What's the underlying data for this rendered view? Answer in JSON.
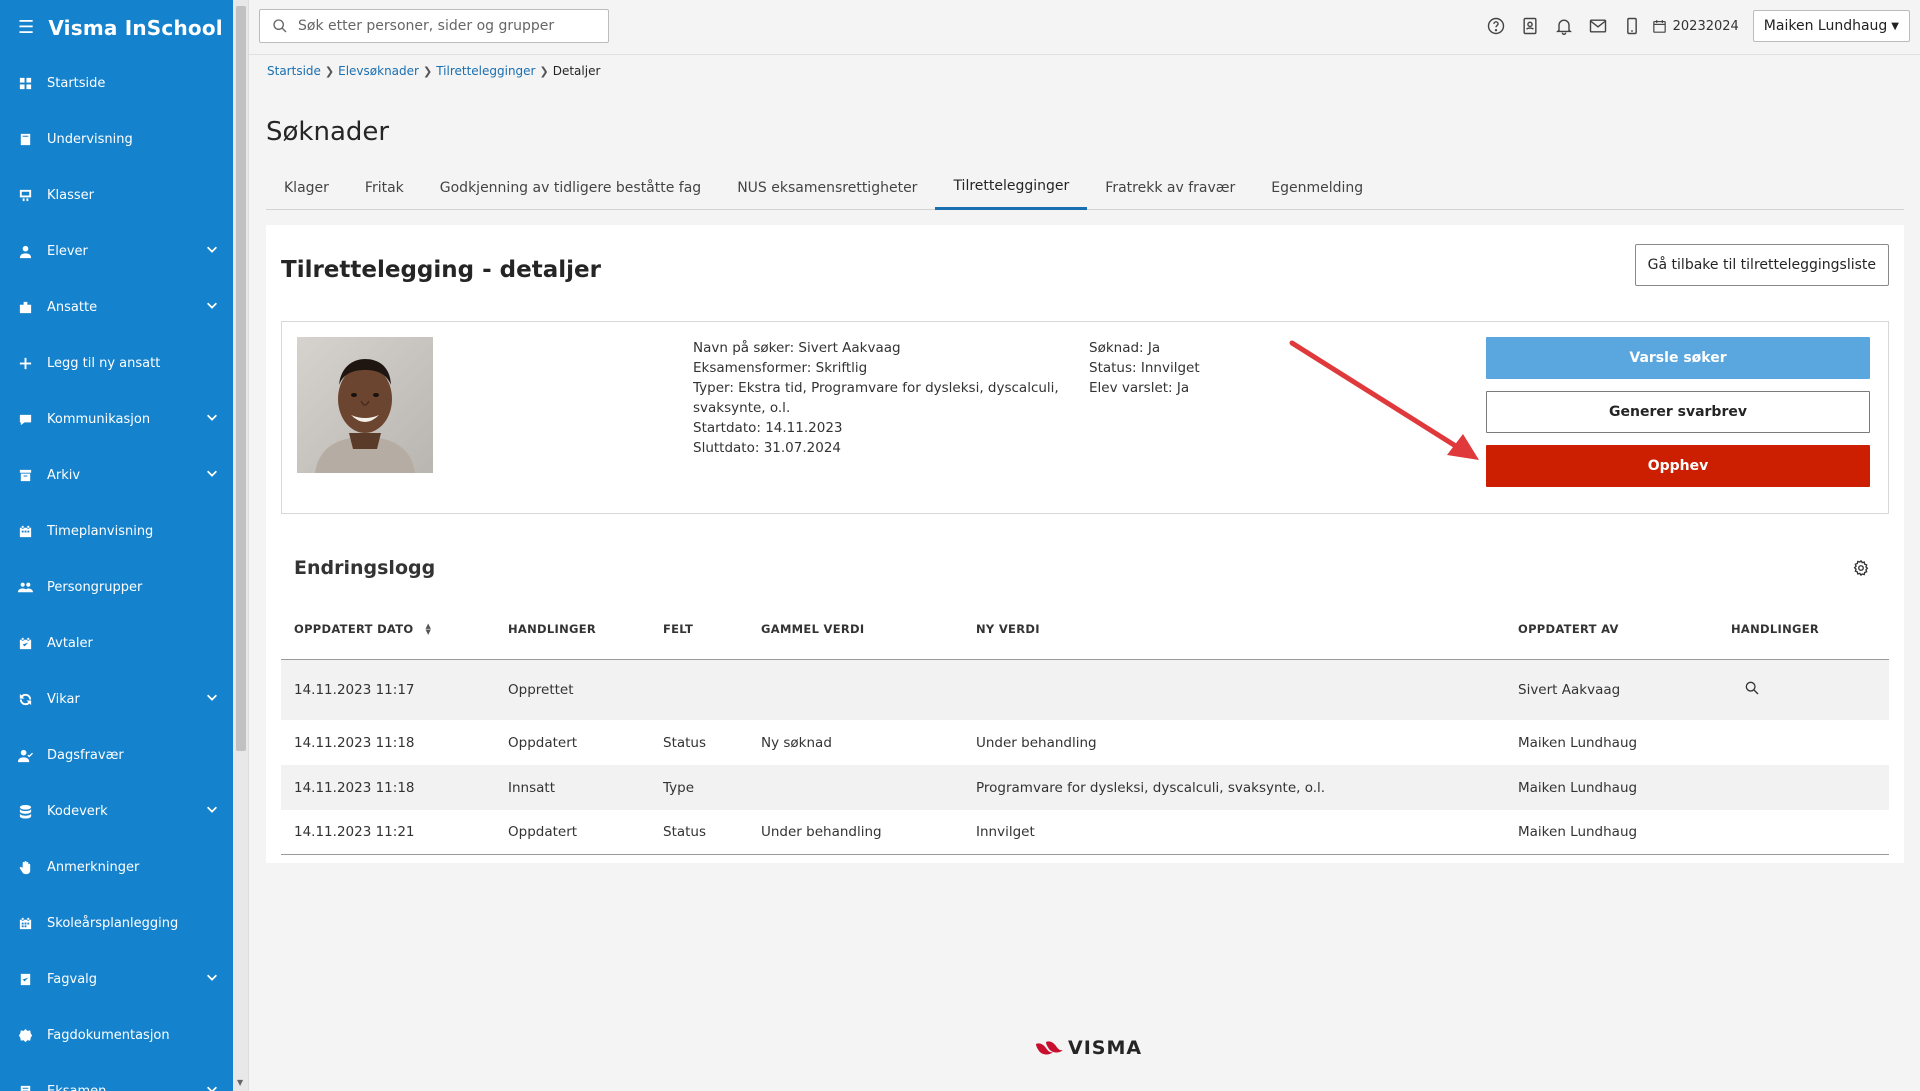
{
  "app": {
    "title": "Visma InSchool"
  },
  "sidebar": {
    "items": [
      {
        "label": "Startside",
        "icon": "grid-icon",
        "expandable": false
      },
      {
        "label": "Undervisning",
        "icon": "book-icon",
        "expandable": false
      },
      {
        "label": "Klasser",
        "icon": "board-icon",
        "expandable": false
      },
      {
        "label": "Elever",
        "icon": "student-icon",
        "expandable": true
      },
      {
        "label": "Ansatte",
        "icon": "briefcase-icon",
        "expandable": true
      },
      {
        "label": "Legg til ny ansatt",
        "icon": "plus-icon",
        "expandable": false
      },
      {
        "label": "Kommunikasjon",
        "icon": "chat-icon",
        "expandable": true
      },
      {
        "label": "Arkiv",
        "icon": "archive-icon",
        "expandable": true
      },
      {
        "label": "Timeplanvisning",
        "icon": "calendar-icon",
        "expandable": false
      },
      {
        "label": "Persongrupper",
        "icon": "group-icon",
        "expandable": false
      },
      {
        "label": "Avtaler",
        "icon": "calendar-check-icon",
        "expandable": false
      },
      {
        "label": "Vikar",
        "icon": "refresh-icon",
        "expandable": true
      },
      {
        "label": "Dagsfravær",
        "icon": "user-check-icon",
        "expandable": false
      },
      {
        "label": "Kodeverk",
        "icon": "database-icon",
        "expandable": true
      },
      {
        "label": "Anmerkninger",
        "icon": "hand-icon",
        "expandable": false
      },
      {
        "label": "Skoleårsplanlegging",
        "icon": "calendar-grid-icon",
        "expandable": false
      },
      {
        "label": "Fagvalg",
        "icon": "book-check-icon",
        "expandable": true
      },
      {
        "label": "Fagdokumentasjon",
        "icon": "badge-icon",
        "expandable": false
      },
      {
        "label": "Eksamen",
        "icon": "exam-icon",
        "expandable": true
      }
    ]
  },
  "topbar": {
    "search_placeholder": "Søk etter personer, sider og grupper",
    "school_year": "20232024",
    "user_name": "Maiken Lundhaug"
  },
  "breadcrumb": {
    "items": [
      "Startside",
      "Elevsøknader",
      "Tilrettelegginger"
    ],
    "current": "Detaljer"
  },
  "page": {
    "title": "Søknader"
  },
  "tabs": [
    {
      "label": "Klager",
      "active": false
    },
    {
      "label": "Fritak",
      "active": false
    },
    {
      "label": "Godkjenning av tidligere beståtte fag",
      "active": false
    },
    {
      "label": "NUS eksamensrettigheter",
      "active": false
    },
    {
      "label": "Tilrettelegginger",
      "active": true
    },
    {
      "label": "Fratrekk av fravær",
      "active": false
    },
    {
      "label": "Egenmelding",
      "active": false
    }
  ],
  "panel": {
    "title": "Tilrettelegging - detaljer",
    "back_button": "Gå tilbake til tilretteleggingsliste"
  },
  "details": {
    "col1": [
      "Navn på søker: Sivert Aakvaag",
      "Eksamensformer: Skriftlig",
      "Typer: Ekstra tid, Programvare for dysleksi, dyscalculi, svaksynte, o.l.",
      "Startdato: 14.11.2023",
      "Sluttdato: 31.07.2024"
    ],
    "col2": [
      "Søknad: Ja",
      "Status: Innvilget",
      "Elev varslet: Ja"
    ],
    "buttons": {
      "notify": "Varsle søker",
      "generate": "Generer svarbrev",
      "revoke": "Opphev"
    }
  },
  "log": {
    "title": "Endringslogg",
    "columns": [
      "OPPDATERT DATO",
      "HANDLINGER",
      "FELT",
      "GAMMEL VERDI",
      "NY VERDI",
      "OPPDATERT AV",
      "HANDLINGER"
    ],
    "rows": [
      {
        "date": "14.11.2023 11:17",
        "action": "Opprettet",
        "field": "",
        "old": "",
        "new": "",
        "by": "Sivert Aakvaag",
        "has_view": true
      },
      {
        "date": "14.11.2023 11:18",
        "action": "Oppdatert",
        "field": "Status",
        "old": "Ny søknad",
        "new": "Under behandling",
        "by": "Maiken Lundhaug",
        "has_view": false
      },
      {
        "date": "14.11.2023 11:18",
        "action": "Innsatt",
        "field": "Type",
        "old": "",
        "new": "Programvare for dysleksi, dyscalculi, svaksynte, o.l.",
        "by": "Maiken Lundhaug",
        "has_view": false
      },
      {
        "date": "14.11.2023 11:21",
        "action": "Oppdatert",
        "field": "Status",
        "old": "Under behandling",
        "new": "Innvilget",
        "by": "Maiken Lundhaug",
        "has_view": false
      }
    ]
  },
  "footer": {
    "logo_text": "VISMA"
  },
  "colors": {
    "sidebar": "#1482cc",
    "link": "#1a6fb0",
    "notify_button": "#5aa7e0",
    "revoke_button": "#cc1e00",
    "annotation_arrow": "#e0393b"
  }
}
